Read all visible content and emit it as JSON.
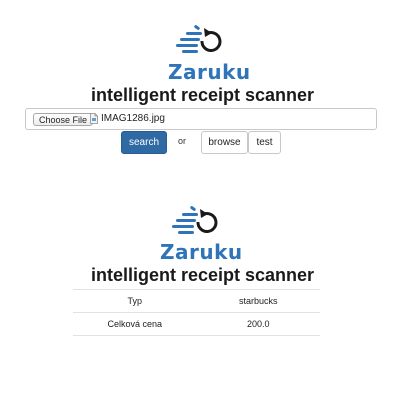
{
  "logo": {
    "name": "Zaruku",
    "brand_color": "#2f74b9",
    "icon": "hand-refresh-icon"
  },
  "app_title": "intelligent receipt scanner",
  "upload": {
    "choose_file_label": "Choose File",
    "file_name": "IMAG1286.jpg",
    "file_icon": "file-icon"
  },
  "actions": {
    "search_label": "search",
    "or_label": "or",
    "browse_label": "browse",
    "test_label": "test",
    "primary_color": "#2f6aa5"
  },
  "results": {
    "rows": [
      {
        "key": "Typ",
        "value": "starbucks"
      },
      {
        "key": "Celková cena",
        "value": "200.0"
      }
    ]
  }
}
